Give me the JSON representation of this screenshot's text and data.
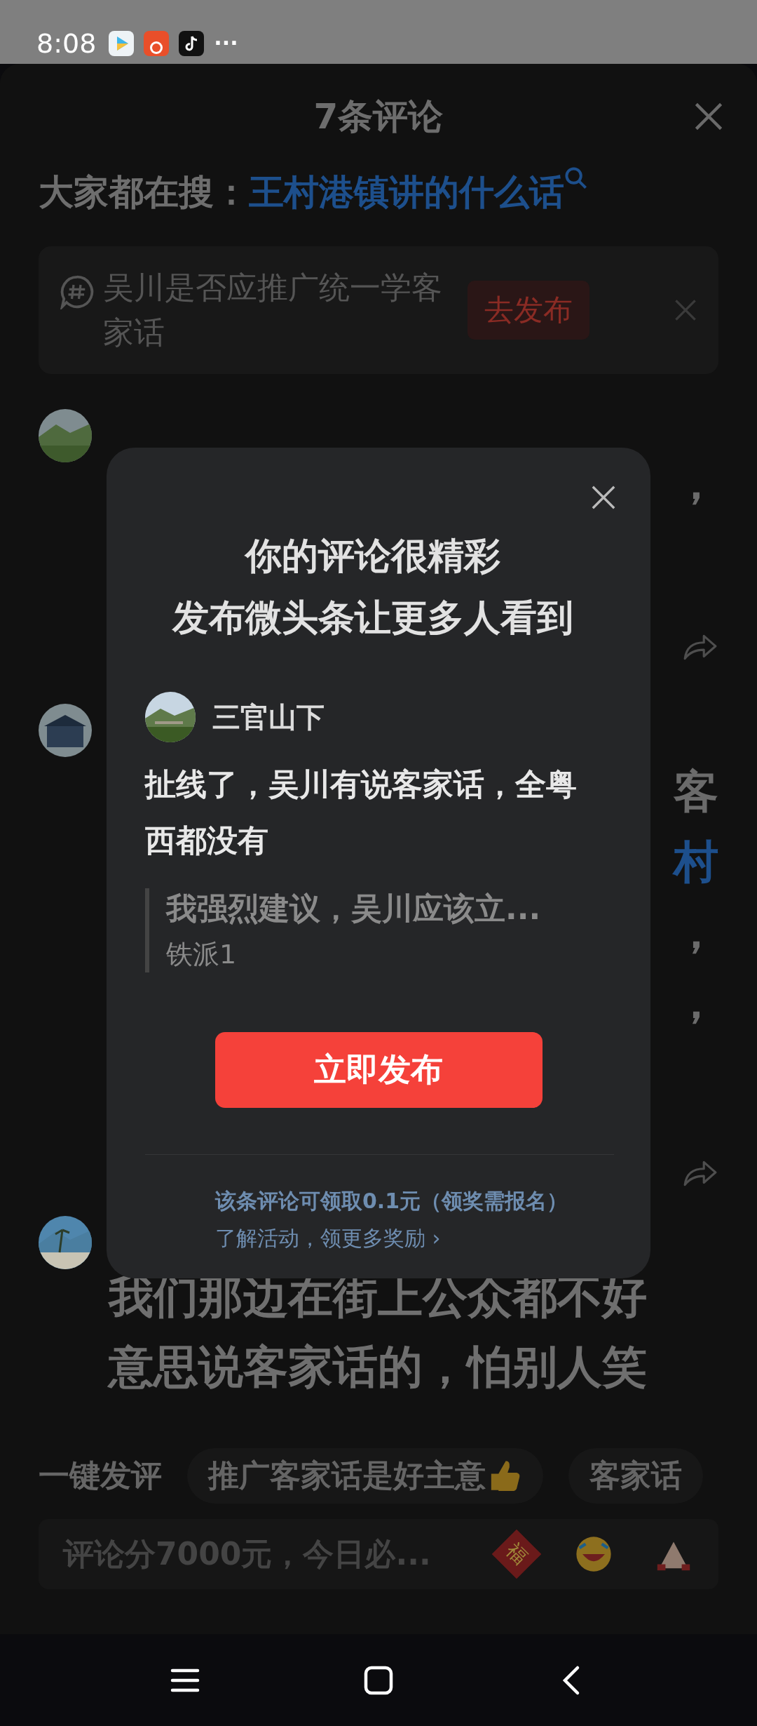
{
  "status_bar": {
    "time": "8:08",
    "more": "···"
  },
  "sheet": {
    "title": "7条评论",
    "search_prefix": "大家都在搜：",
    "search_term": "王村港镇讲的什么话"
  },
  "topic_card": {
    "text": "吴川是否应推广统一学客家话",
    "button": "去发布"
  },
  "comments": [
    {
      "fragments": [
        {
          "text": "，",
          "link": false
        }
      ],
      "share": true
    },
    {
      "fragments": [
        {
          "text": "客",
          "link": false
        },
        {
          "text": "村",
          "link": true
        },
        {
          "text": "，",
          "link": false
        },
        {
          "text": "，",
          "link": false
        }
      ],
      "share": true
    },
    {
      "share": false,
      "lines": [
        "我们那边在街上公众都不好",
        "意思说客家话的，怕别人笑"
      ]
    }
  ],
  "quick_reply": {
    "label": "一键发评",
    "chips": [
      "推广客家话是好主意",
      "客家话"
    ]
  },
  "input": {
    "placeholder": "评论分7000元，今日必...",
    "fu": "福"
  },
  "dialog": {
    "title_lines": [
      "你的评论很精彩",
      "发布微头条让更多人看到"
    ],
    "user": "三官山下",
    "comment": "扯线了，吴川有说客家话，全粤西都没有",
    "quote_text": "我强烈建议，吴川应该立...",
    "quote_author": "铁派1",
    "button": "立即发布",
    "reward": "该条评论可领取0.1元（领奖需报名）",
    "link": "了解活动，领更多奖励 ›"
  }
}
